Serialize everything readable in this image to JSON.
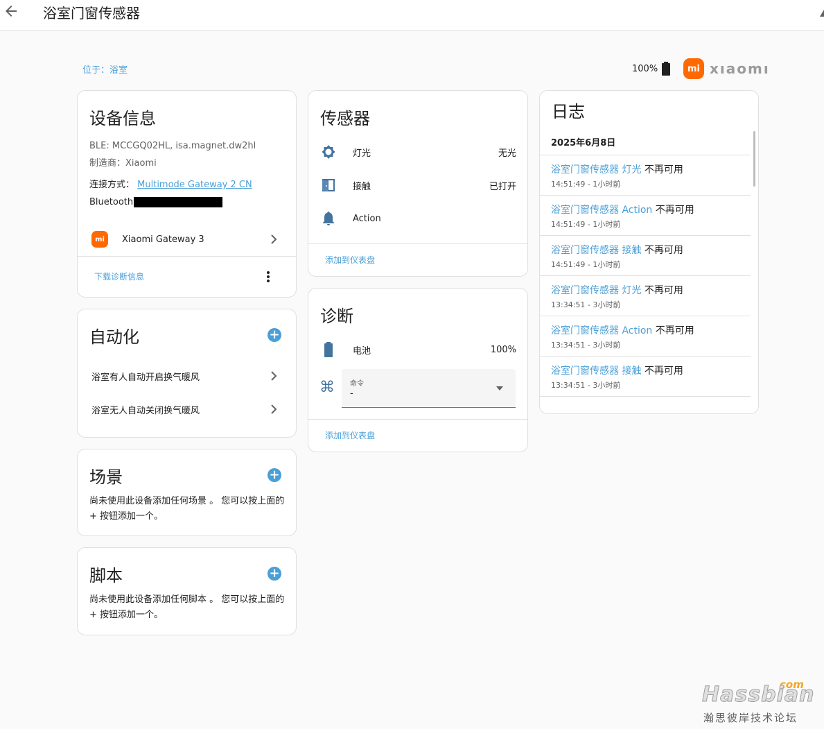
{
  "header": {
    "title": "浴室门窗传感器"
  },
  "location": "位于：浴室",
  "battery_top": "100%",
  "brand": {
    "name": "xıaomı"
  },
  "device_info": {
    "title": "设备信息",
    "ble": "BLE: MCCGQ02HL, isa.magnet.dw2hl",
    "manufacturer": "制造商：Xiaomi",
    "connection_label": "连接方式：",
    "connection_link": "Multimode Gateway 2 CN",
    "bluetooth_label": "Bluetooth",
    "gateway_name": "Xiaomi Gateway 3",
    "download_label": "下载诊断信息"
  },
  "automation": {
    "title": "自动化",
    "items": [
      "浴室有人自动开启换气暖风",
      "浴室无人自动关闭换气暖风"
    ]
  },
  "scene": {
    "title": "场景",
    "text": "尚未使用此设备添加任何场景 。 您可以按上面的 + 按钮添加一个。"
  },
  "script": {
    "title": "脚本",
    "text": "尚未使用此设备添加任何脚本 。 您可以按上面的 + 按钮添加一个。"
  },
  "sensors": {
    "title": "传感器",
    "items": [
      {
        "label": "灯光",
        "value": "无光",
        "icon": "brightness-icon"
      },
      {
        "label": "接触",
        "value": "已打开",
        "icon": "door-open-icon"
      },
      {
        "label": "Action",
        "value": "",
        "icon": "bell-icon"
      }
    ],
    "add_label": "添加到仪表盘"
  },
  "diagnostics": {
    "title": "诊断",
    "battery_label": "电池",
    "battery_value": "100%",
    "command_label": "命令",
    "command_value": "-",
    "add_label": "添加到仪表盘"
  },
  "log": {
    "title": "日志",
    "date": "2025年6月8日",
    "entries": [
      {
        "entity": "浴室门窗传感器 灯光",
        "status": " 不再可用",
        "time": "14:51:49 - 1小时前"
      },
      {
        "entity": "浴室门窗传感器 Action",
        "status": " 不再可用",
        "time": "14:51:49 - 1小时前"
      },
      {
        "entity": "浴室门窗传感器 接触",
        "status": " 不再可用",
        "time": "14:51:49 - 1小时前"
      },
      {
        "entity": "浴室门窗传感器 灯光",
        "status": " 不再可用",
        "time": "13:34:51 - 3小时前"
      },
      {
        "entity": "浴室门窗传感器 Action",
        "status": " 不再可用",
        "time": "13:34:51 - 3小时前"
      },
      {
        "entity": "浴室门窗传感器 接触",
        "status": " 不再可用",
        "time": "13:34:51 - 3小时前"
      }
    ]
  },
  "watermark": {
    "logo": "Hassbian",
    "com": "com",
    "subtitle": "瀚思彼岸技术论坛"
  },
  "colors": {
    "accent": "#4a9fd7",
    "brand": "#ff6900",
    "icon": "#44739e"
  }
}
